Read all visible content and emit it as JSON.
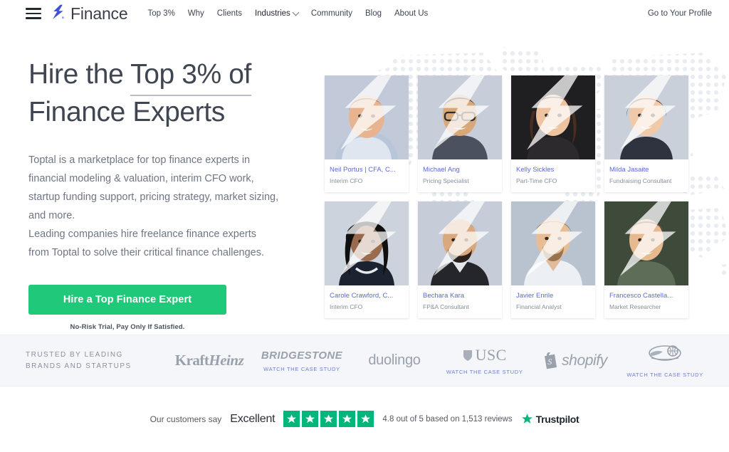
{
  "header": {
    "menu_icon": "hamburger-icon",
    "brand": "Finance",
    "nav": [
      {
        "label": "Top 3%",
        "has_caret": false
      },
      {
        "label": "Why",
        "has_caret": false
      },
      {
        "label": "Clients",
        "has_caret": false
      },
      {
        "label": "Industries",
        "has_caret": true
      },
      {
        "label": "Community",
        "has_caret": false
      },
      {
        "label": "Blog",
        "has_caret": false
      },
      {
        "label": "About Us",
        "has_caret": false
      }
    ],
    "profile_link": "Go to Your Profile"
  },
  "hero": {
    "title_line1_a": "Hire the ",
    "title_line1_b": "Top 3% of",
    "title_line2": "Finance Experts",
    "description_lines": [
      "Toptal is a marketplace for top finance experts in",
      "financial modeling & valuation, interim CFO work,",
      "startup funding support, pricing strategy, market sizing,",
      "and more.",
      "Leading companies hire freelance finance experts",
      "from Toptal to solve their critical finance challenges."
    ],
    "cta_label": "Hire a Top Finance Expert",
    "cta_note": "No-Risk Trial, Pay Only If Satisfied.",
    "cta_color": "#20c87a"
  },
  "experts": [
    {
      "name": "Neil Portus | CFA, C...",
      "role": "Interim CFO"
    },
    {
      "name": "Michael Ang",
      "role": "Pricing Specialist"
    },
    {
      "name": "Kelly Sickles",
      "role": "Part-Time CFO"
    },
    {
      "name": "Milda Jasaite",
      "role": "Fundraising Consultant"
    },
    {
      "name": "Carole Crawford, C...",
      "role": "Interim CFO"
    },
    {
      "name": "Bechara Kara",
      "role": "FP&A Consultant"
    },
    {
      "name": "Javier Enrile",
      "role": "Financial Analyst"
    },
    {
      "name": "Francesco Castella...",
      "role": "Market Researcher"
    }
  ],
  "brands": {
    "label_line1": "TRUSTED BY LEADING",
    "label_line2": "BRANDS AND STARTUPS",
    "case_study_label": "WATCH THE CASE STUDY",
    "logos": [
      {
        "name": "Kraft Heinz",
        "kraft": "Kraft",
        "heinz": "Heinz",
        "case_study": false
      },
      {
        "name": "BRIDGESTONE",
        "case_study": true
      },
      {
        "name": "duolingo",
        "case_study": false
      },
      {
        "name": "USC",
        "case_study": true
      },
      {
        "name": "shopify",
        "case_study": false
      },
      {
        "name": "Harlem Globetrotters",
        "case_study": true
      }
    ]
  },
  "trustpilot": {
    "say": "Our customers say",
    "rating_word": "Excellent",
    "stars": 5,
    "star_color": "#00b67a",
    "summary": "4.8 out of 5 based on 1,513 reviews",
    "brand_name": "Trustpilot"
  }
}
